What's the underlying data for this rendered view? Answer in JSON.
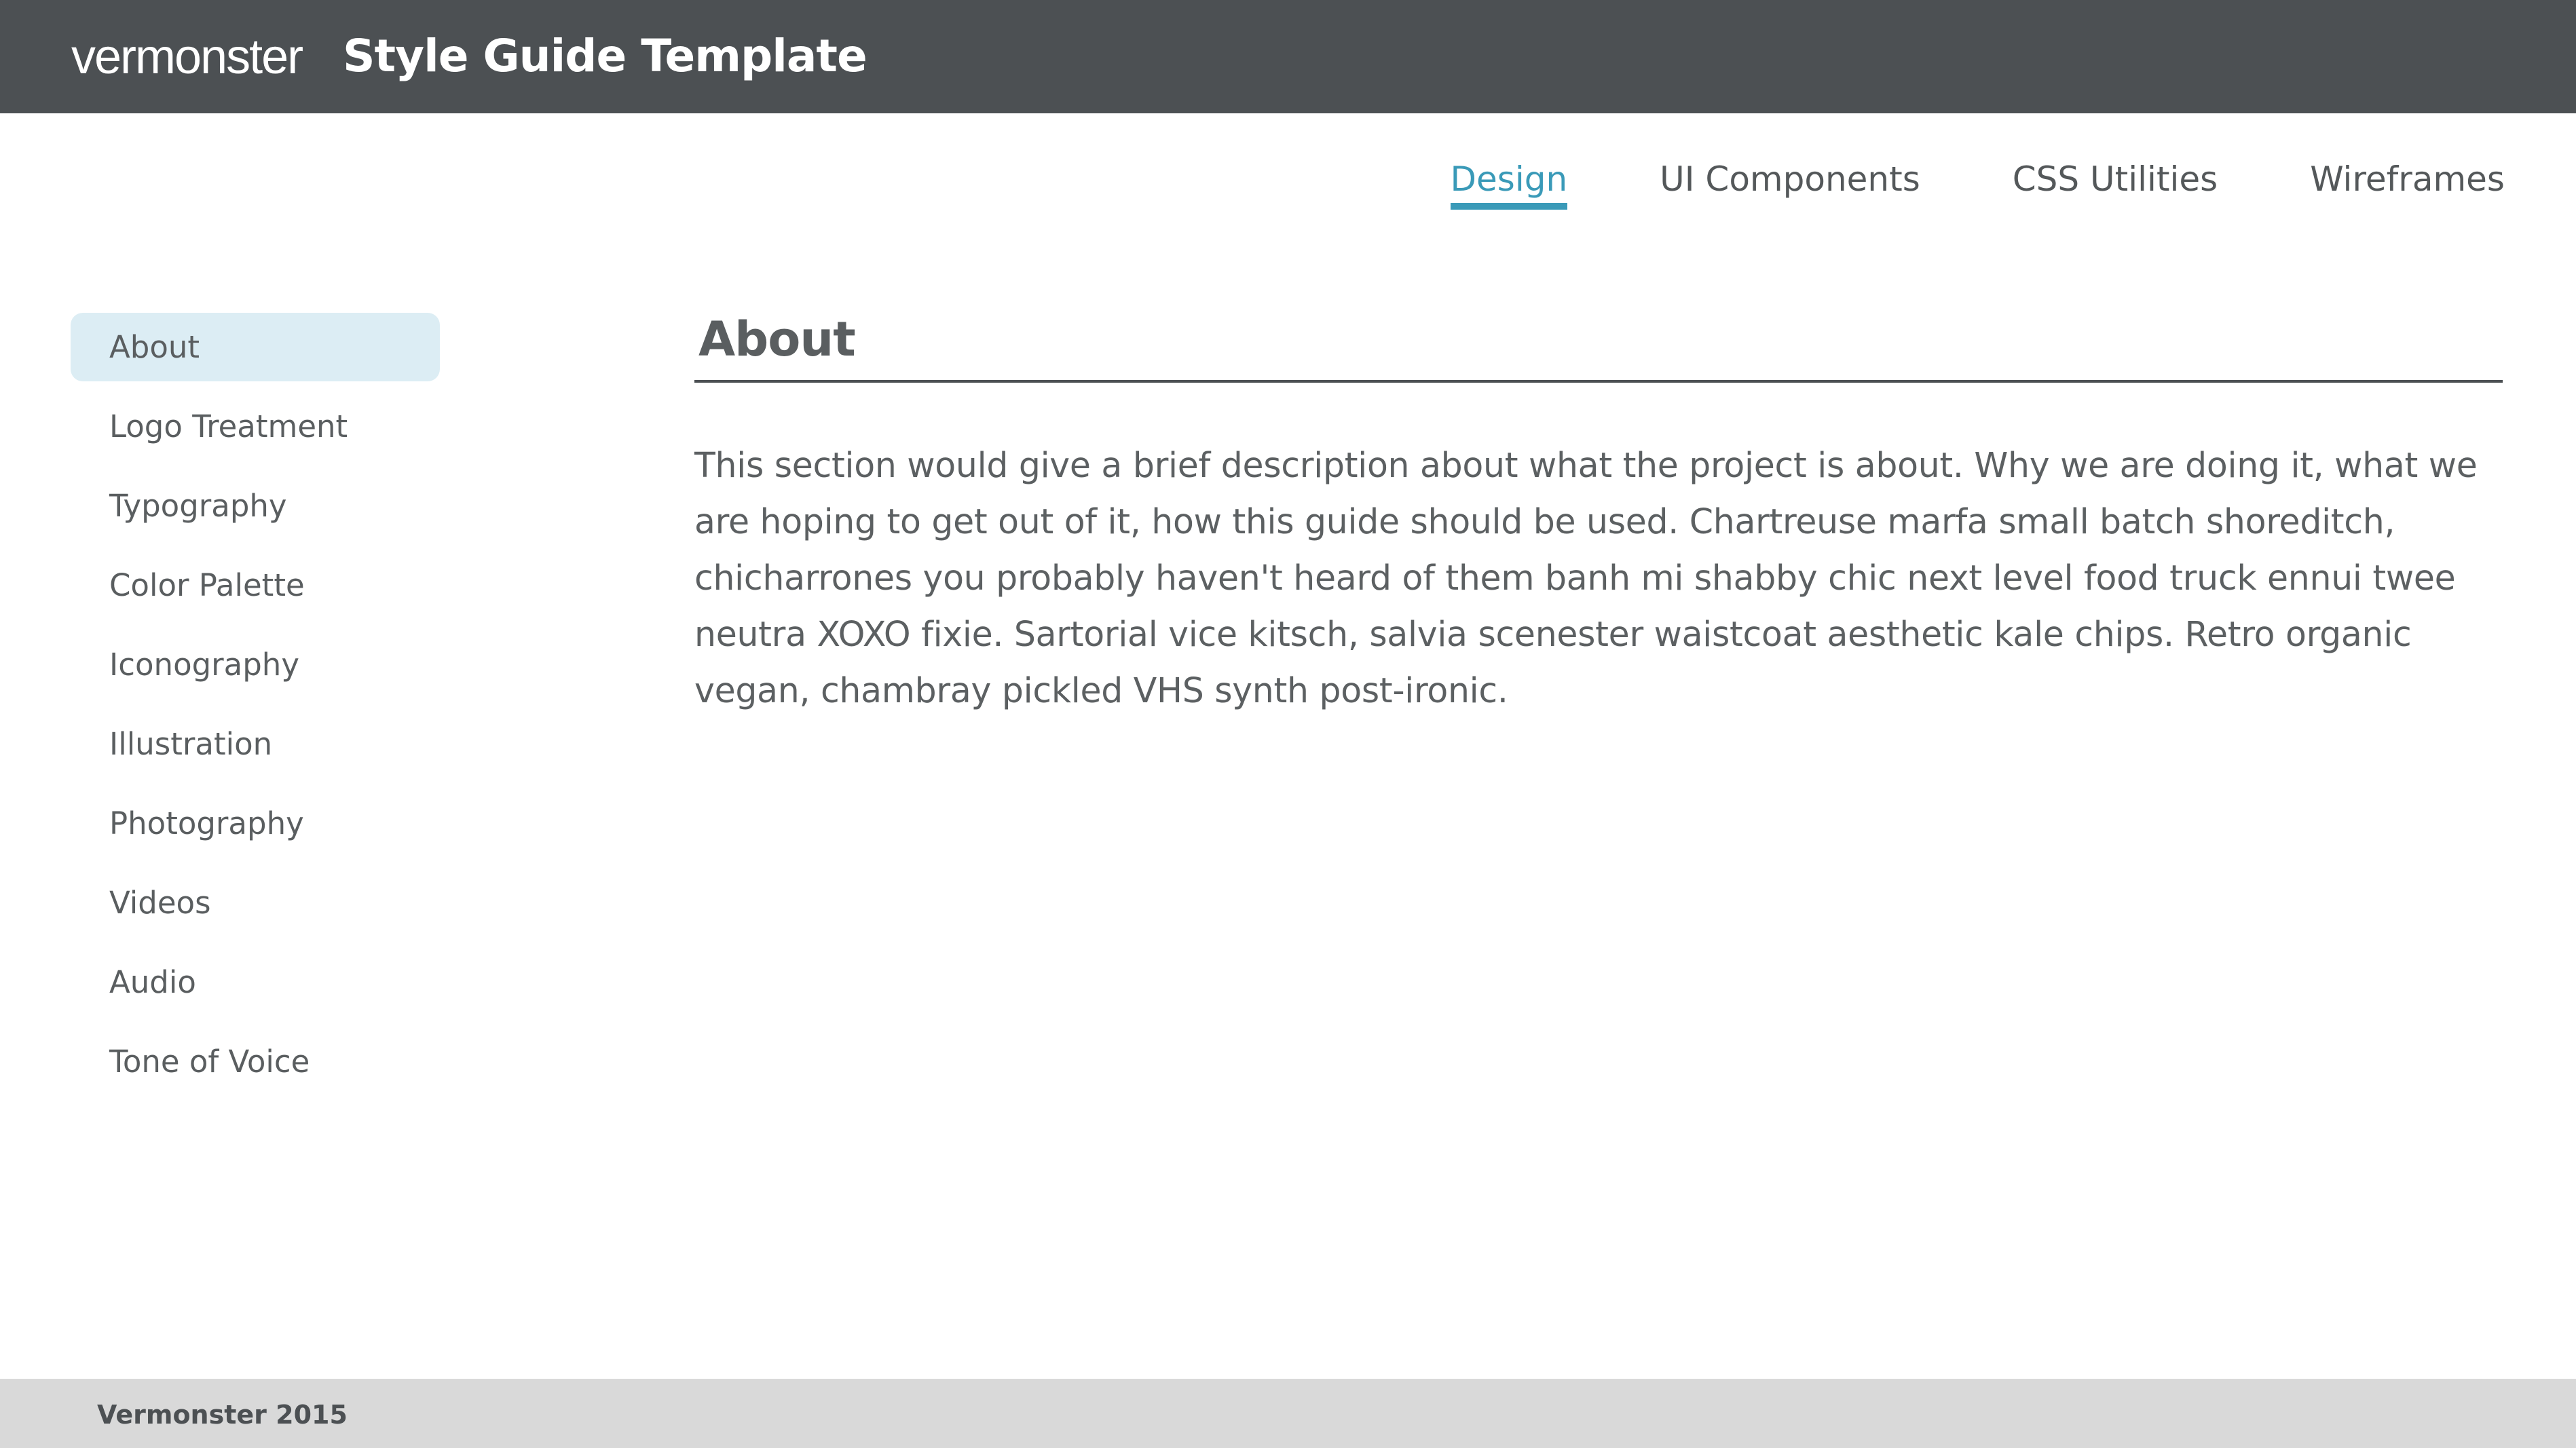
{
  "header": {
    "logo_text": "vermonster",
    "title": "Style Guide Template"
  },
  "topnav": {
    "tabs": [
      {
        "label": "Design",
        "active": true
      },
      {
        "label": "UI Components",
        "active": false
      },
      {
        "label": "CSS Utilities",
        "active": false
      },
      {
        "label": "Wireframes",
        "active": false
      }
    ]
  },
  "sidebar": {
    "items": [
      {
        "label": "About",
        "active": true
      },
      {
        "label": "Logo Treatment",
        "active": false
      },
      {
        "label": "Typography",
        "active": false
      },
      {
        "label": "Color Palette",
        "active": false
      },
      {
        "label": "Iconography",
        "active": false
      },
      {
        "label": "Illustration",
        "active": false
      },
      {
        "label": "Photography",
        "active": false
      },
      {
        "label": "Videos",
        "active": false
      },
      {
        "label": "Audio",
        "active": false
      },
      {
        "label": "Tone of Voice",
        "active": false
      }
    ]
  },
  "main": {
    "section_title": "About",
    "body": "This section would give a brief description about what the project is about. Why we are doing it, what we are hoping to get out of it, how this guide should be used. Chartreuse marfa small batch shoreditch, chicharrones you probably haven't heard of them banh mi shabby chic next level food truck ennui twee neutra XOXO fixie. Sartorial vice kitsch, salvia scenester waistcoat aesthetic kale chips. Retro organic vegan, chambray pickled VHS synth post-ironic."
  },
  "footer": {
    "text": "Vermonster 2015"
  },
  "colors": {
    "header_bg": "#4c5053",
    "accent": "#3a9ab8",
    "active_item_bg": "#dcedf4",
    "footer_bg": "#d9d9d9"
  }
}
